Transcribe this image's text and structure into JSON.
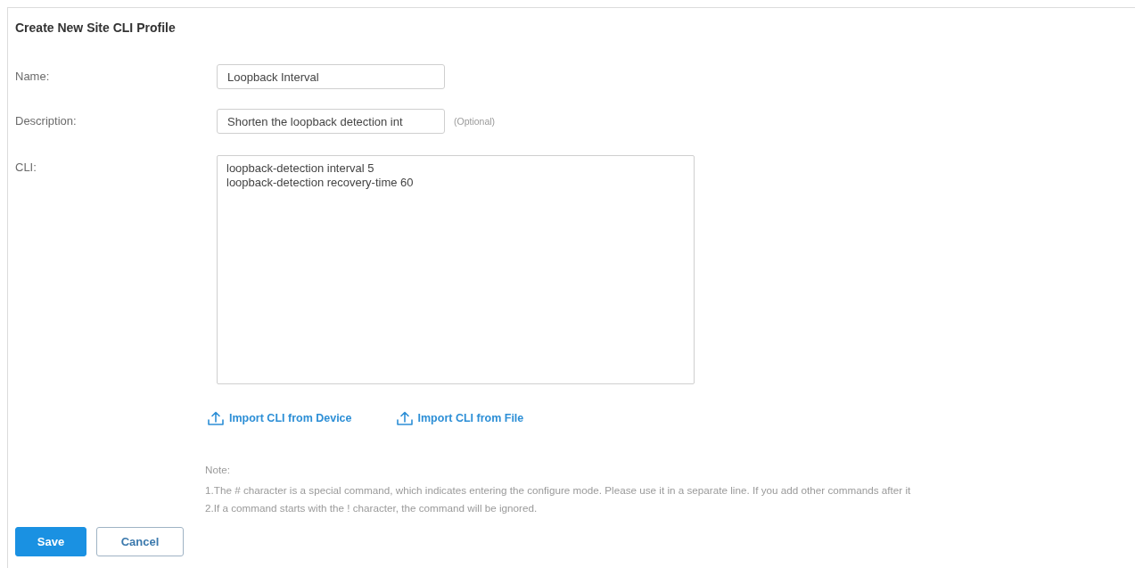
{
  "title": "Create New Site CLI Profile",
  "fields": [
    {
      "kind": "text",
      "label": "Name:",
      "value": "Loopback Interval"
    },
    {
      "kind": "text",
      "label": "Description:",
      "value": "Shorten the loopback detection int",
      "hint": "(Optional)"
    },
    {
      "kind": "textarea",
      "label": "CLI:",
      "lines": [
        "loopback-detection interval 5",
        "loopback-detection recovery-time 60"
      ]
    }
  ],
  "import_links": [
    "Import CLI from Device",
    "Import CLI from File"
  ],
  "note": {
    "heading": "Note:",
    "lines": [
      "1.The # character is a special command, which indicates entering the configure mode. Please use it in a separate line. If you add other commands after it",
      "2.If a command starts with the ! character, the command will be ignored."
    ]
  },
  "buttons": [
    {
      "kind": "primary",
      "label": "Save"
    },
    {
      "kind": "secondary",
      "label": "Cancel"
    }
  ]
}
